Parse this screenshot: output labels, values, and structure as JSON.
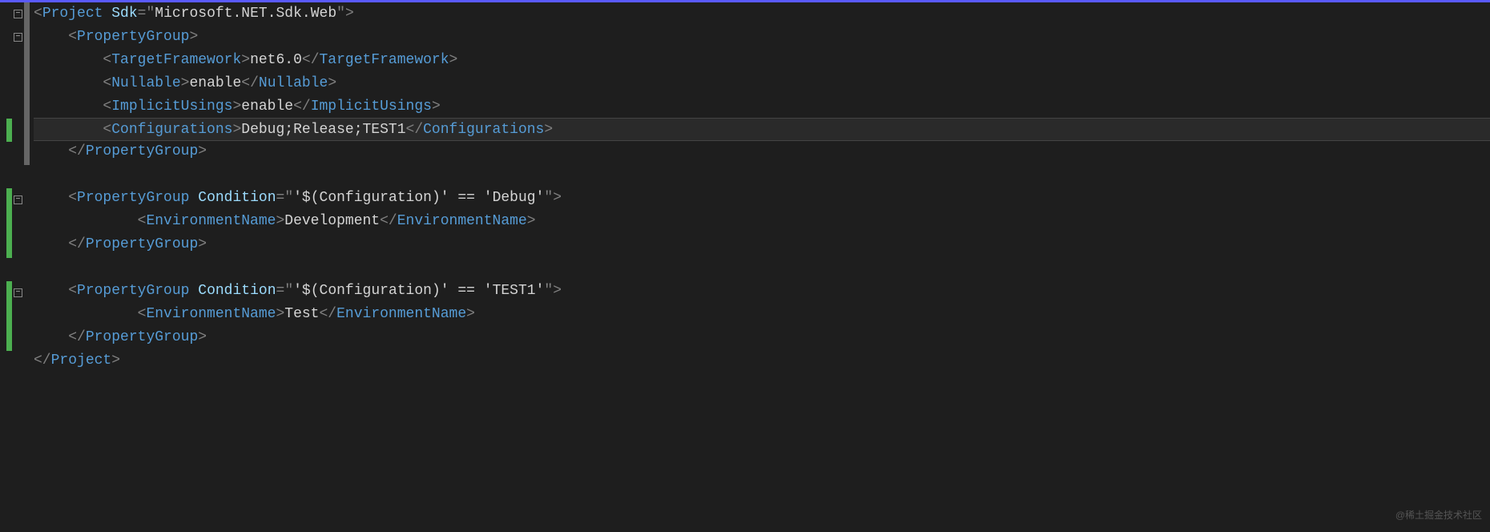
{
  "watermark": "@稀土掘金技术社区",
  "code": {
    "lines": [
      {
        "hl": false,
        "indent": 0,
        "tokens": [
          {
            "c": "p",
            "t": "<"
          },
          {
            "c": "el",
            "t": "Project"
          },
          {
            "c": "tx",
            "t": " "
          },
          {
            "c": "at",
            "t": "Sdk"
          },
          {
            "c": "p",
            "t": "="
          },
          {
            "c": "p",
            "t": "\""
          },
          {
            "c": "st",
            "t": "Microsoft.NET.Sdk.Web"
          },
          {
            "c": "p",
            "t": "\""
          },
          {
            "c": "p",
            "t": ">"
          }
        ]
      },
      {
        "hl": false,
        "indent": 1,
        "tokens": [
          {
            "c": "p",
            "t": "<"
          },
          {
            "c": "el",
            "t": "PropertyGroup"
          },
          {
            "c": "p",
            "t": ">"
          }
        ]
      },
      {
        "hl": false,
        "indent": 2,
        "tokens": [
          {
            "c": "p",
            "t": "<"
          },
          {
            "c": "el",
            "t": "TargetFramework"
          },
          {
            "c": "p",
            "t": ">"
          },
          {
            "c": "tx",
            "t": "net6.0"
          },
          {
            "c": "p",
            "t": "</"
          },
          {
            "c": "el",
            "t": "TargetFramework"
          },
          {
            "c": "p",
            "t": ">"
          }
        ]
      },
      {
        "hl": false,
        "indent": 2,
        "tokens": [
          {
            "c": "p",
            "t": "<"
          },
          {
            "c": "el",
            "t": "Nullable"
          },
          {
            "c": "p",
            "t": ">"
          },
          {
            "c": "tx",
            "t": "enable"
          },
          {
            "c": "p",
            "t": "</"
          },
          {
            "c": "el",
            "t": "Nullable"
          },
          {
            "c": "p",
            "t": ">"
          }
        ]
      },
      {
        "hl": false,
        "indent": 2,
        "tokens": [
          {
            "c": "p",
            "t": "<"
          },
          {
            "c": "el",
            "t": "ImplicitUsings"
          },
          {
            "c": "p",
            "t": ">"
          },
          {
            "c": "tx",
            "t": "enable"
          },
          {
            "c": "p",
            "t": "</"
          },
          {
            "c": "el",
            "t": "ImplicitUsings"
          },
          {
            "c": "p",
            "t": ">"
          }
        ]
      },
      {
        "hl": true,
        "indent": 2,
        "tokens": [
          {
            "c": "p",
            "t": "<"
          },
          {
            "c": "el",
            "t": "Configurations"
          },
          {
            "c": "p",
            "t": ">"
          },
          {
            "c": "tx",
            "t": "Debug;Release;TEST1"
          },
          {
            "c": "p",
            "t": "</"
          },
          {
            "c": "el",
            "t": "Configurations"
          },
          {
            "c": "p",
            "t": ">"
          }
        ]
      },
      {
        "hl": false,
        "indent": 1,
        "tokens": [
          {
            "c": "p",
            "t": "</"
          },
          {
            "c": "el",
            "t": "PropertyGroup"
          },
          {
            "c": "p",
            "t": ">"
          }
        ]
      },
      {
        "hl": false,
        "indent": 0,
        "tokens": []
      },
      {
        "hl": false,
        "indent": 1,
        "tokens": [
          {
            "c": "p",
            "t": "<"
          },
          {
            "c": "el",
            "t": "PropertyGroup"
          },
          {
            "c": "tx",
            "t": " "
          },
          {
            "c": "at",
            "t": "Condition"
          },
          {
            "c": "p",
            "t": "="
          },
          {
            "c": "p",
            "t": "\""
          },
          {
            "c": "st",
            "t": "'$(Configuration)' == 'Debug'"
          },
          {
            "c": "p",
            "t": "\""
          },
          {
            "c": "p",
            "t": ">"
          }
        ]
      },
      {
        "hl": false,
        "indent": 3,
        "tokens": [
          {
            "c": "p",
            "t": "<"
          },
          {
            "c": "el",
            "t": "EnvironmentName"
          },
          {
            "c": "p",
            "t": ">"
          },
          {
            "c": "tx",
            "t": "Development"
          },
          {
            "c": "p",
            "t": "</"
          },
          {
            "c": "el",
            "t": "EnvironmentName"
          },
          {
            "c": "p",
            "t": ">"
          }
        ]
      },
      {
        "hl": false,
        "indent": 1,
        "tokens": [
          {
            "c": "p",
            "t": "</"
          },
          {
            "c": "el",
            "t": "PropertyGroup"
          },
          {
            "c": "p",
            "t": ">"
          }
        ]
      },
      {
        "hl": false,
        "indent": 0,
        "tokens": []
      },
      {
        "hl": false,
        "indent": 1,
        "tokens": [
          {
            "c": "p",
            "t": "<"
          },
          {
            "c": "el",
            "t": "PropertyGroup"
          },
          {
            "c": "tx",
            "t": " "
          },
          {
            "c": "at",
            "t": "Condition"
          },
          {
            "c": "p",
            "t": "="
          },
          {
            "c": "p",
            "t": "\""
          },
          {
            "c": "st",
            "t": "'$(Configuration)' == 'TEST1'"
          },
          {
            "c": "p",
            "t": "\""
          },
          {
            "c": "p",
            "t": ">"
          }
        ]
      },
      {
        "hl": false,
        "indent": 3,
        "tokens": [
          {
            "c": "p",
            "t": "<"
          },
          {
            "c": "el",
            "t": "EnvironmentName"
          },
          {
            "c": "p",
            "t": ">"
          },
          {
            "c": "tx",
            "t": "Test"
          },
          {
            "c": "p",
            "t": "</"
          },
          {
            "c": "el",
            "t": "EnvironmentName"
          },
          {
            "c": "p",
            "t": ">"
          }
        ]
      },
      {
        "hl": false,
        "indent": 1,
        "tokens": [
          {
            "c": "p",
            "t": "</"
          },
          {
            "c": "el",
            "t": "PropertyGroup"
          },
          {
            "c": "p",
            "t": ">"
          }
        ]
      },
      {
        "hl": false,
        "indent": 0,
        "tokens": [
          {
            "c": "p",
            "t": "</"
          },
          {
            "c": "el",
            "t": "Project"
          },
          {
            "c": "p",
            "t": ">"
          }
        ]
      }
    ]
  },
  "gutter": {
    "folds": [
      {
        "line": 0
      },
      {
        "line": 1
      },
      {
        "line": 8
      },
      {
        "line": 12
      }
    ],
    "track": {
      "start": 0,
      "end": 7
    },
    "changes": [
      {
        "start": 5,
        "end": 6
      },
      {
        "start": 8,
        "end": 11
      },
      {
        "start": 12,
        "end": 15
      }
    ]
  }
}
